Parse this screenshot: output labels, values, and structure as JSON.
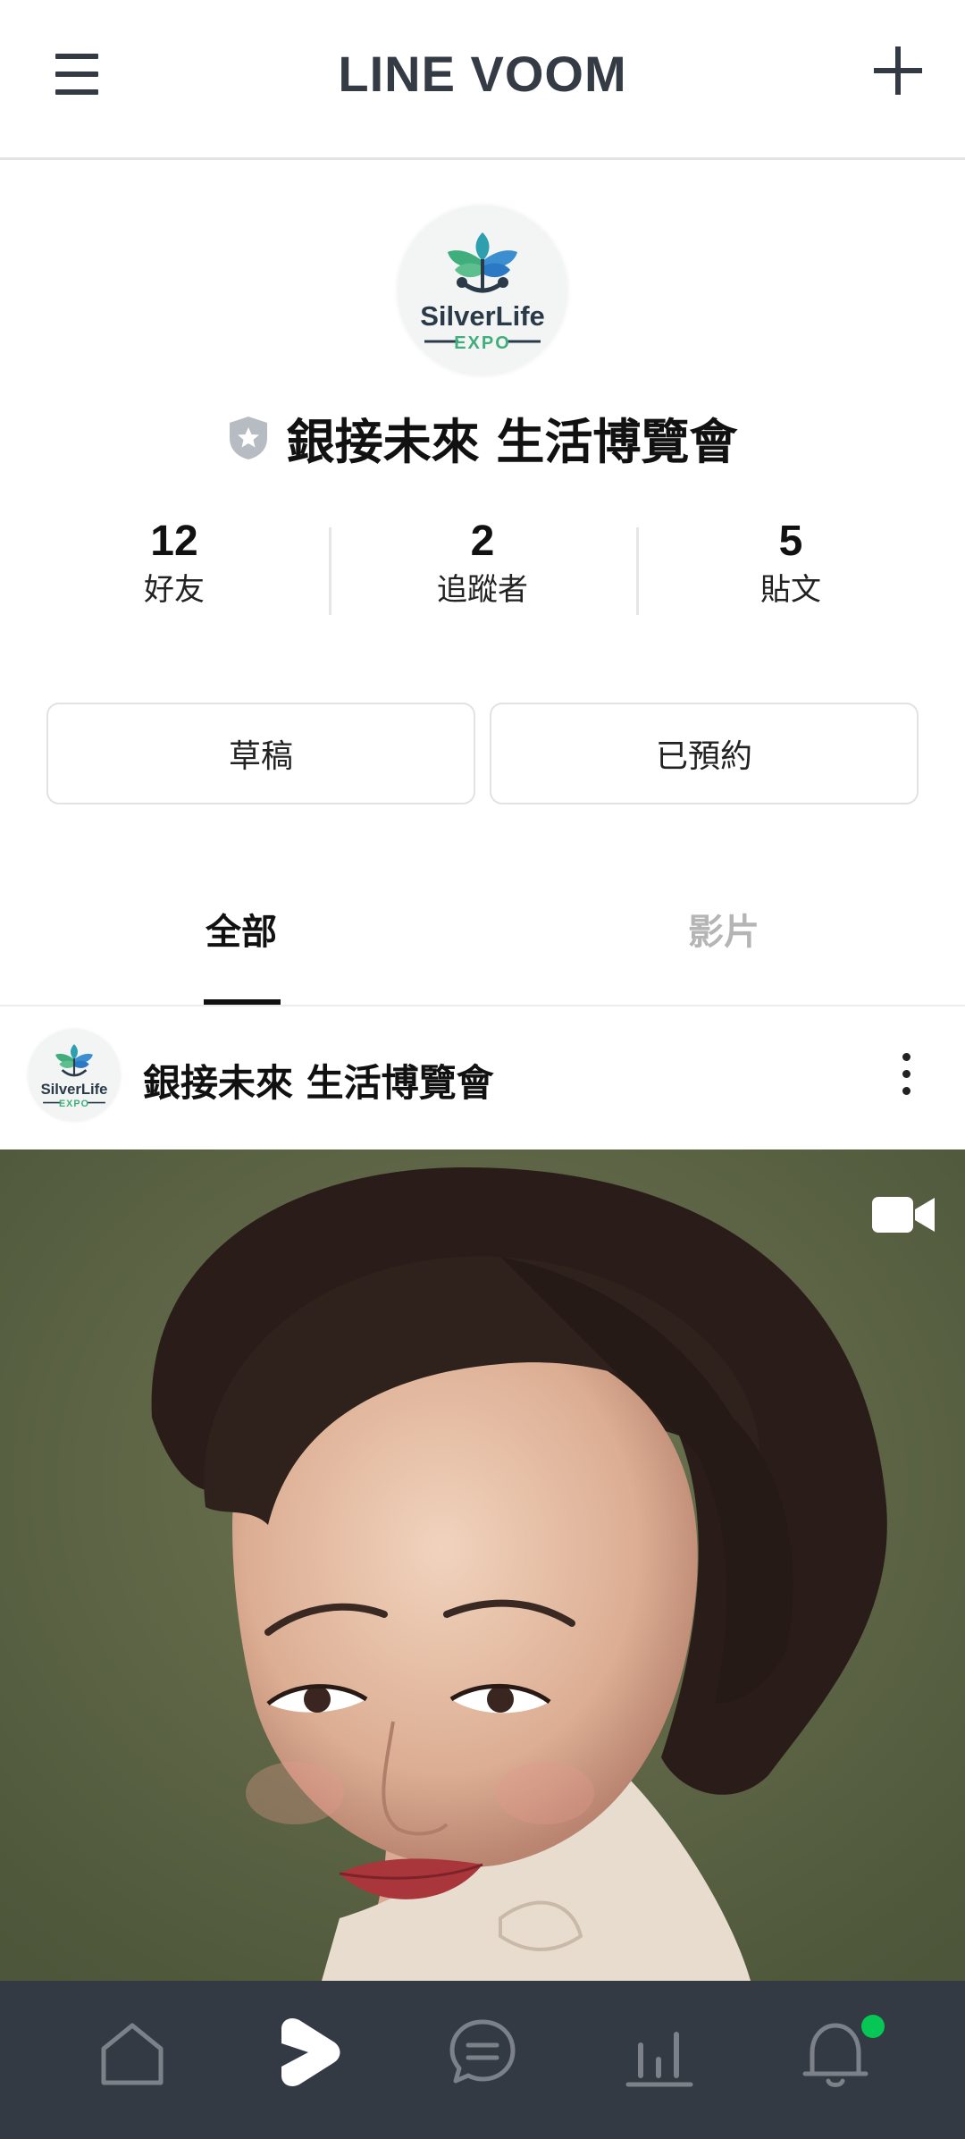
{
  "header": {
    "title": "LINE VOOM"
  },
  "profile": {
    "logo_text": "SilverLife",
    "logo_subtext": "EXPO",
    "name": "銀接未來 生活博覽會",
    "stats": [
      {
        "value": "12",
        "label": "好友"
      },
      {
        "value": "2",
        "label": "追蹤者"
      },
      {
        "value": "5",
        "label": "貼文"
      }
    ],
    "buttons": {
      "drafts": "草稿",
      "scheduled": "已預約"
    }
  },
  "tabs": [
    {
      "label": "全部",
      "active": true
    },
    {
      "label": "影片",
      "active": false
    }
  ],
  "post": {
    "author": "銀接未來 生活博覽會",
    "logo_text": "SilverLife",
    "logo_subtext": "EXPO",
    "media_type": "video-icon"
  },
  "bottom_nav": {
    "items": [
      "home-icon",
      "voom-icon",
      "chat-icon",
      "stats-icon",
      "bell-icon"
    ],
    "active": "voom-icon",
    "notification_badge_color": "#06c755"
  },
  "colors": {
    "accent": "#06c755",
    "nav_background": "#343a43",
    "header_text": "#353b45"
  }
}
